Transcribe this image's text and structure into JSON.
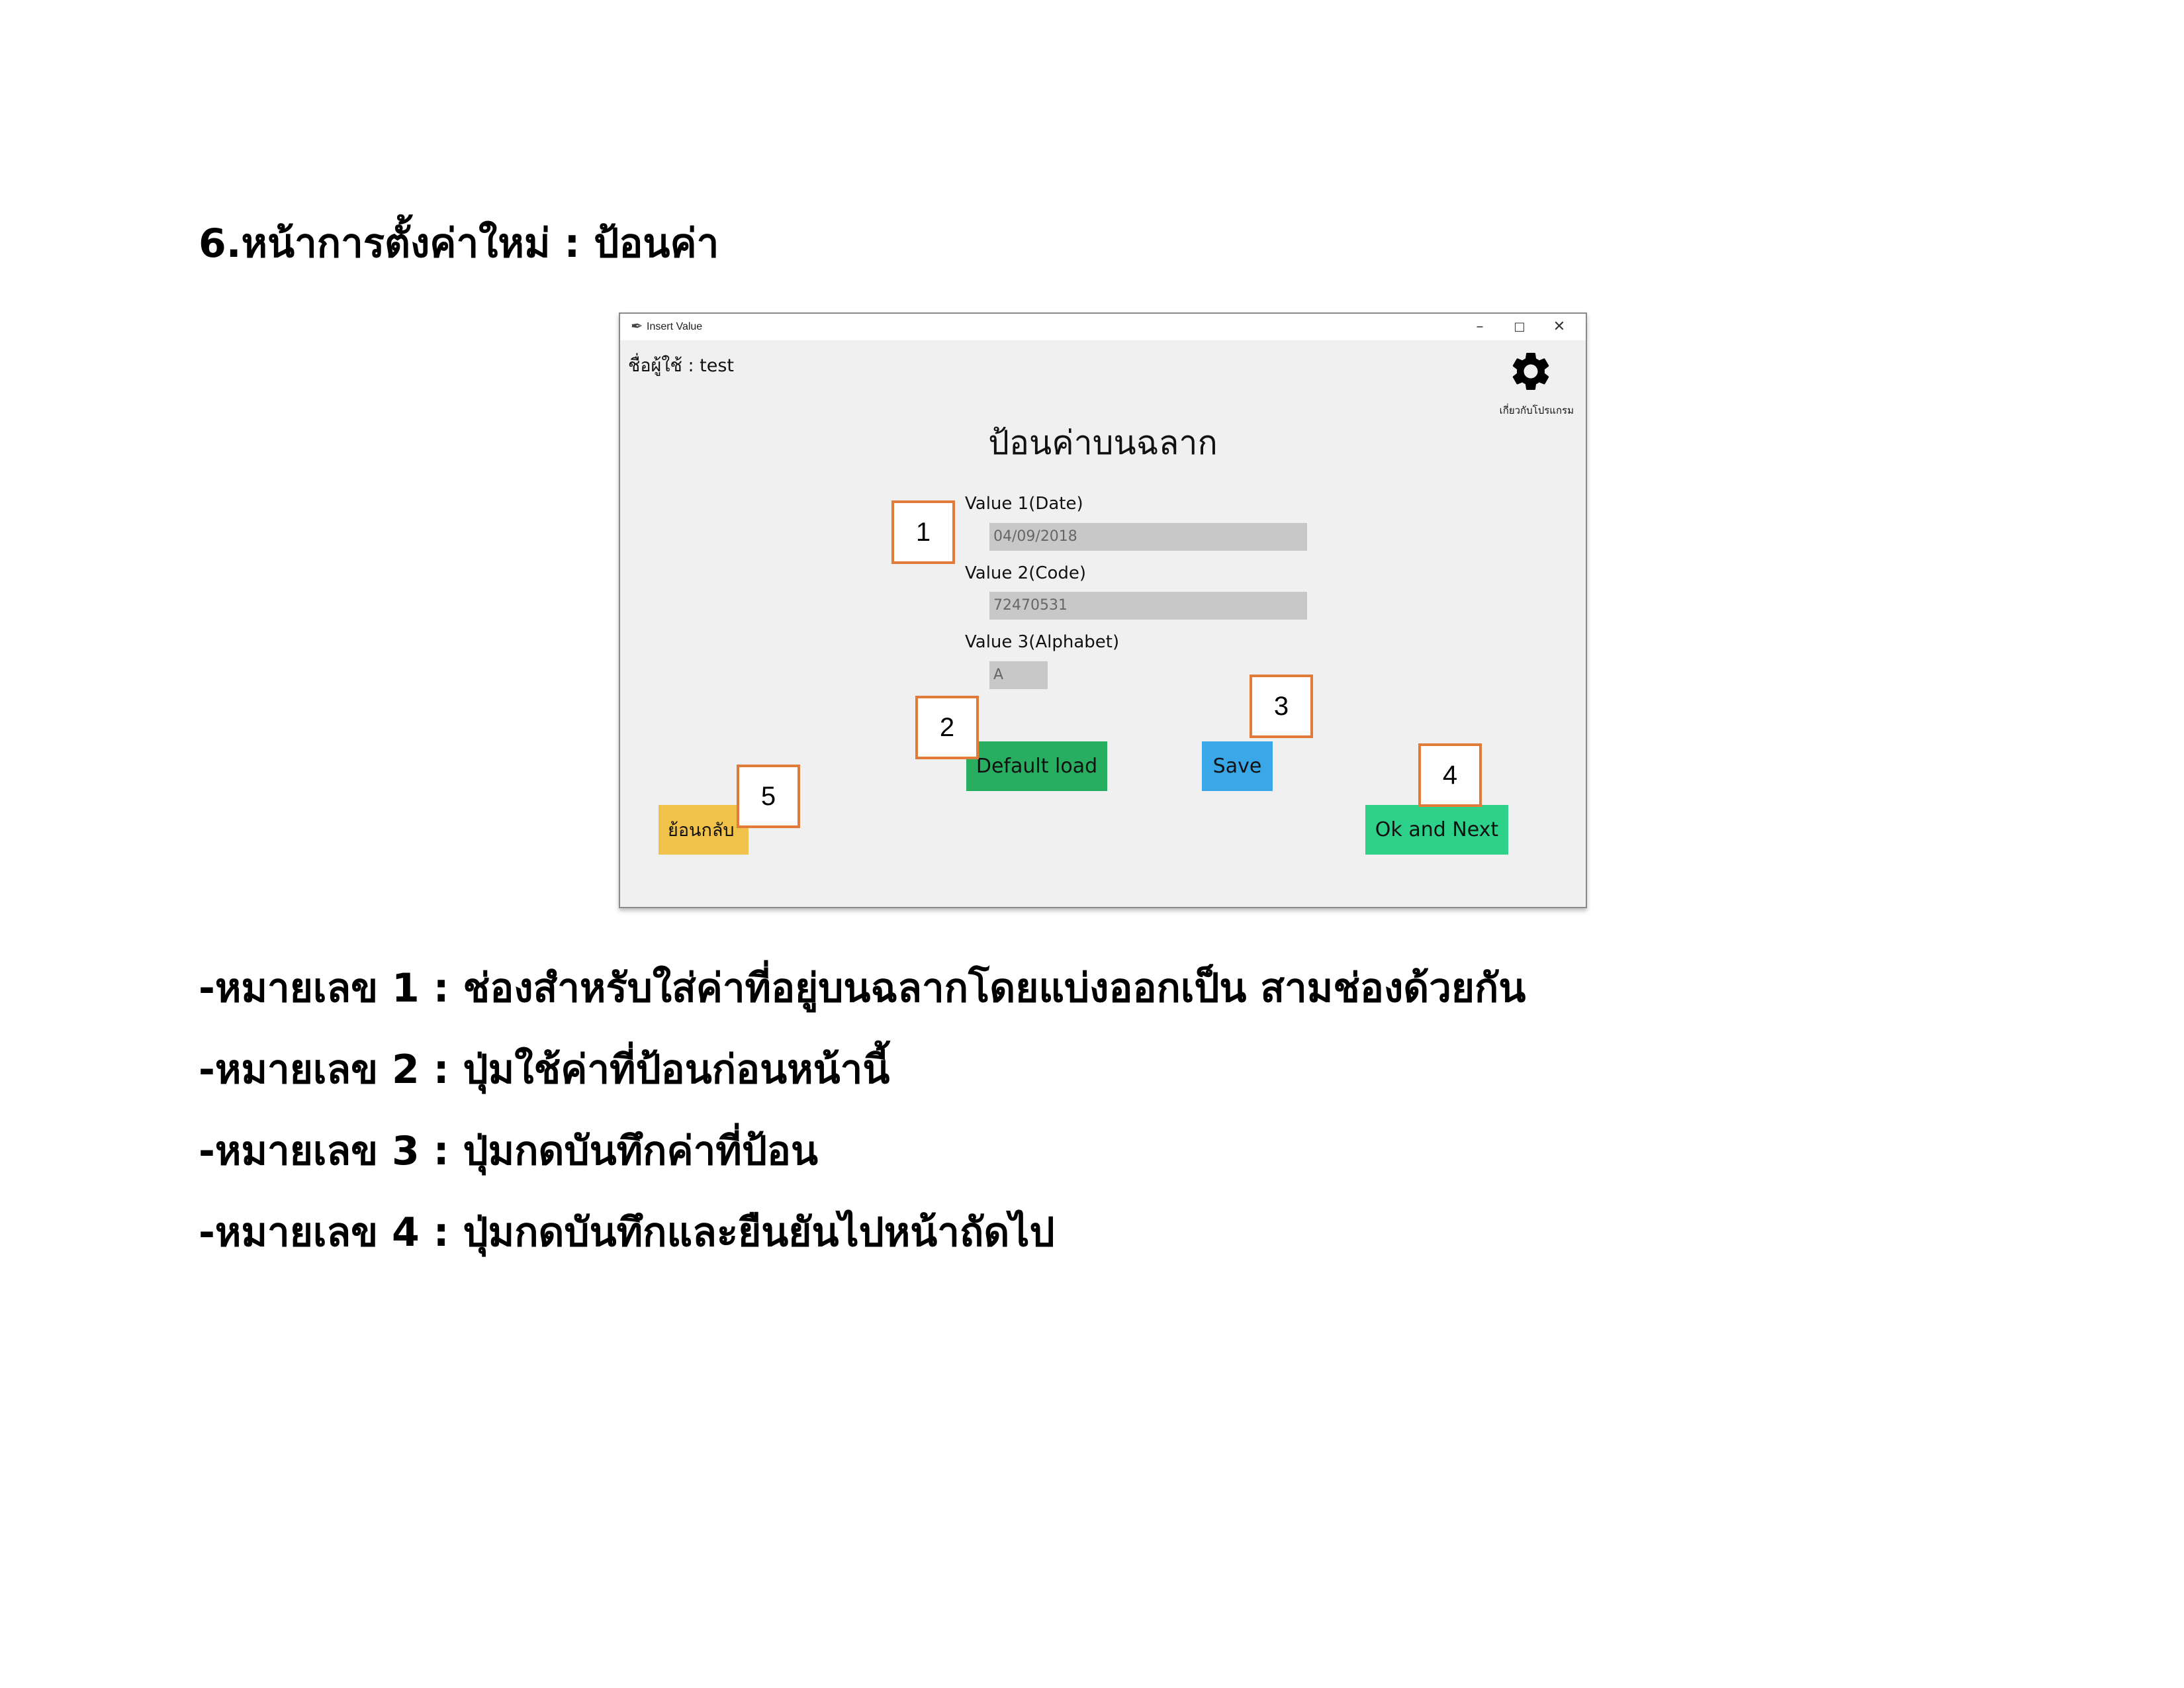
{
  "doc": {
    "heading": "6.หน้าการตั้งค่าใหม่ : ป้อนค่า",
    "descriptions": [
      "-หมายเลข 1 : ช่องสำหรับใส่ค่าที่อยู่บนฉลากโดยแบ่งออกเป็น สามช่องด้วยกัน",
      "-หมายเลข 2 : ปุ่มใช้ค่าที่ป้อนก่อนหน้านี้",
      "-หมายเลข 3 : ปุ่มกดบันทึกค่าที่ป้อน",
      "-หมายเลข 4 : ปุ่มกดบันทึกและยืนยันไปหน้าถัดไป"
    ]
  },
  "window": {
    "title": "Insert Value",
    "user_line": "ชื่อผู้ใช้ : test",
    "about_label": "เกี่ยวกับโปรแกรม",
    "form_title": "ป้อนค่าบนฉลาก",
    "fields": [
      {
        "label": "Value 1(Date)",
        "value": "04/09/2018"
      },
      {
        "label": "Value 2(Code)",
        "value": "72470531"
      },
      {
        "label": "Value 3(Alphabet)",
        "value": "A"
      }
    ],
    "buttons": {
      "default_load": "Default load",
      "save": "Save",
      "ok_next": "Ok and Next",
      "back": "ย้อนกลับ"
    },
    "colors": {
      "default_load": "#27ae60",
      "save": "#3aa8e8",
      "ok_next": "#2ed18a",
      "back": "#f0c24a",
      "callout_border": "#e07b39"
    }
  },
  "callouts": [
    "1",
    "2",
    "3",
    "4",
    "5"
  ]
}
